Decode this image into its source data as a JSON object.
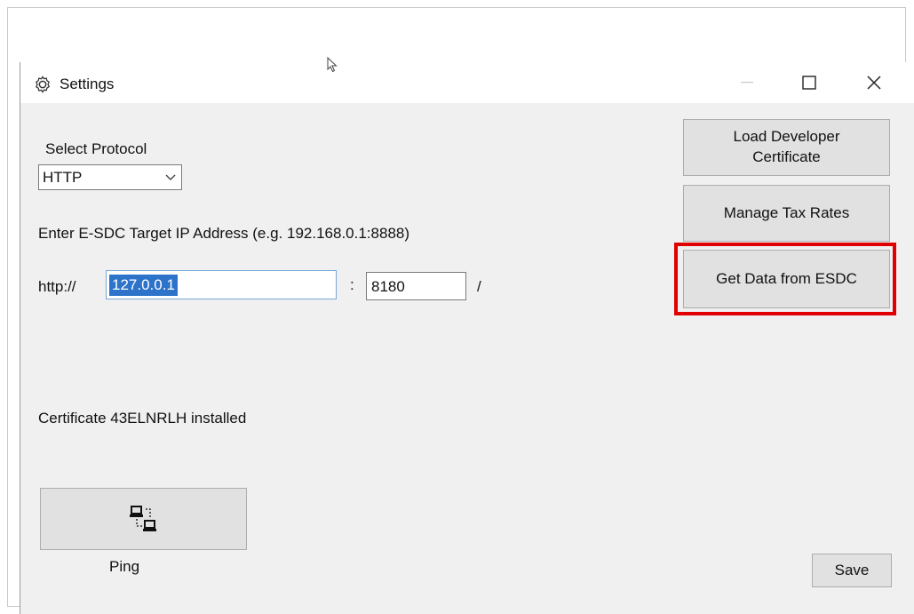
{
  "window": {
    "title": "Settings",
    "controls": {
      "minimize_icon": "minimize-icon",
      "maximize_icon": "maximize-icon",
      "close_icon": "close-icon"
    }
  },
  "protocol": {
    "label": "Select Protocol",
    "selected": "HTTP"
  },
  "target": {
    "label": "Enter E-SDC Target IP Address (e.g. 192.168.0.1:8888)",
    "scheme": "http://",
    "ip_value": "127.0.0.1",
    "colon": ":",
    "port_value": "8180",
    "slash": "/"
  },
  "certificate_status": "Certificate 43ELNRLH installed",
  "buttons": {
    "load_developer_certificate": "Load Developer Certificate",
    "manage_tax_rates": "Manage Tax Rates",
    "get_data_from_esdc": "Get Data from ESDC",
    "ping": "Ping",
    "save": "Save"
  },
  "colors": {
    "highlight": "#e00000",
    "selection": "#2d73c9",
    "window_bg": "#f0f0f0",
    "button_bg": "#e1e1e1"
  }
}
